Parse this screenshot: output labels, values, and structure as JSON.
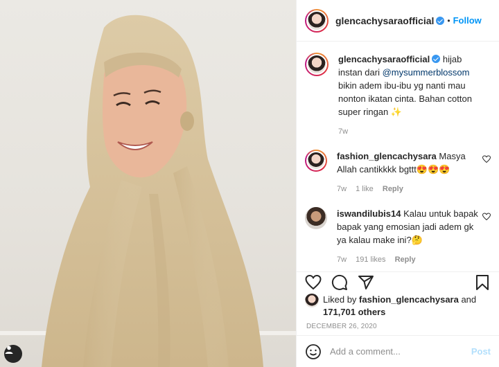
{
  "post": {
    "author": "glencachysaraofficial",
    "follow_label": "Follow",
    "dot": "•",
    "more_icon": "more-options-icon"
  },
  "caption": {
    "author": "glencachysaraofficial",
    "text_before": "hijab instan dari ",
    "mention": "@mysummerblossom",
    "text_after": " bikin adem ibu-ibu yg nanti mau nonton ikatan cinta. Bahan cotton super ringan ✨",
    "time": "7w"
  },
  "comments": [
    {
      "author": "fashion_glencachysara",
      "text": "Masya Allah cantikkkk bgttt😍😍😍",
      "time": "7w",
      "likes": "1 like",
      "reply": "Reply"
    },
    {
      "author": "iswandilubis14",
      "text": "Kalau untuk bapak bapak yang emosian jadi adem gk ya kalau make ini?🤔",
      "time": "7w",
      "likes": "191 likes",
      "reply": "Reply"
    }
  ],
  "likes": {
    "prefix": "Liked by ",
    "user": "fashion_glencachysara",
    "middle": " and",
    "count": "171,701 others"
  },
  "date": "DECEMBER 26, 2020",
  "add_comment": {
    "placeholder": "Add a comment...",
    "post_label": "Post"
  },
  "colors": {
    "accent": "#0095f6",
    "verified": "#3897f0",
    "hijab": "#d8c7a3"
  }
}
